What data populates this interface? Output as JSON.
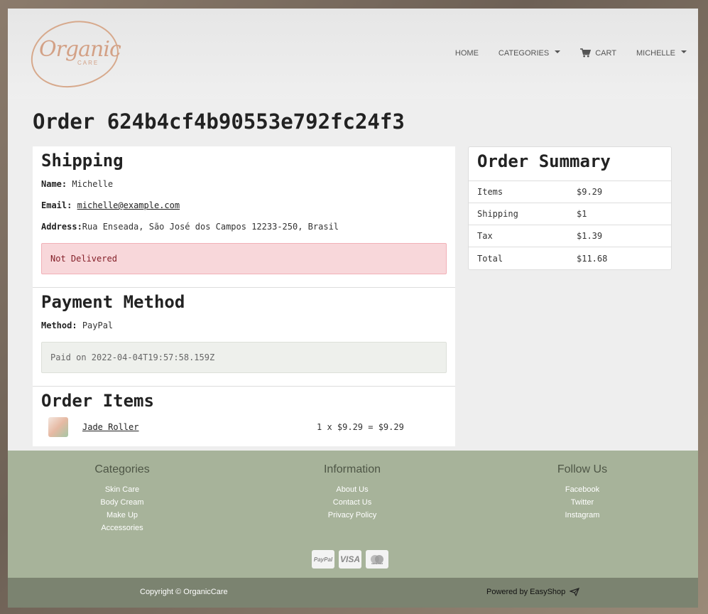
{
  "brand": {
    "logo_text": "Organic",
    "logo_sub": "CARE"
  },
  "nav": {
    "home": "HOME",
    "categories": "CATEGORIES",
    "cart": "CART",
    "user": "MICHELLE"
  },
  "page_title": "Order 624b4cf4b90553e792fc24f3",
  "shipping": {
    "heading": "Shipping",
    "name_label": "Name:",
    "name_value": "Michelle",
    "email_label": "Email:",
    "email_value": "michelle@example.com",
    "address_label": "Address:",
    "address_value": "Rua Enseada, São José dos Campos 12233-250, Brasil",
    "status": "Not Delivered"
  },
  "payment": {
    "heading": "Payment Method",
    "method_label": "Method:",
    "method_value": "PayPal",
    "status": "Paid on 2022-04-04T19:57:58.159Z"
  },
  "order_items": {
    "heading": "Order Items",
    "items": [
      {
        "name": "Jade Roller",
        "price_line": "1 x $9.29 = $9.29"
      }
    ]
  },
  "summary": {
    "heading": "Order Summary",
    "rows": [
      {
        "label": "Items",
        "value": "$9.29"
      },
      {
        "label": "Shipping",
        "value": "$1"
      },
      {
        "label": "Tax",
        "value": "$1.39"
      },
      {
        "label": "Total",
        "value": "$11.68"
      }
    ]
  },
  "footer": {
    "categories": {
      "heading": "Categories",
      "links": [
        "Skin Care",
        "Body Cream",
        "Make Up",
        "Accessories"
      ]
    },
    "information": {
      "heading": "Information",
      "links": [
        "About Us",
        "Contact Us",
        "Privacy Policy"
      ]
    },
    "follow": {
      "heading": "Follow Us",
      "links": [
        "Facebook",
        "Twitter",
        "Instagram"
      ]
    },
    "payments": [
      "PayPal",
      "VISA",
      "mastercard"
    ],
    "copyright": "Copyright © OrganicCare",
    "powered": "Powered by EasyShop"
  }
}
